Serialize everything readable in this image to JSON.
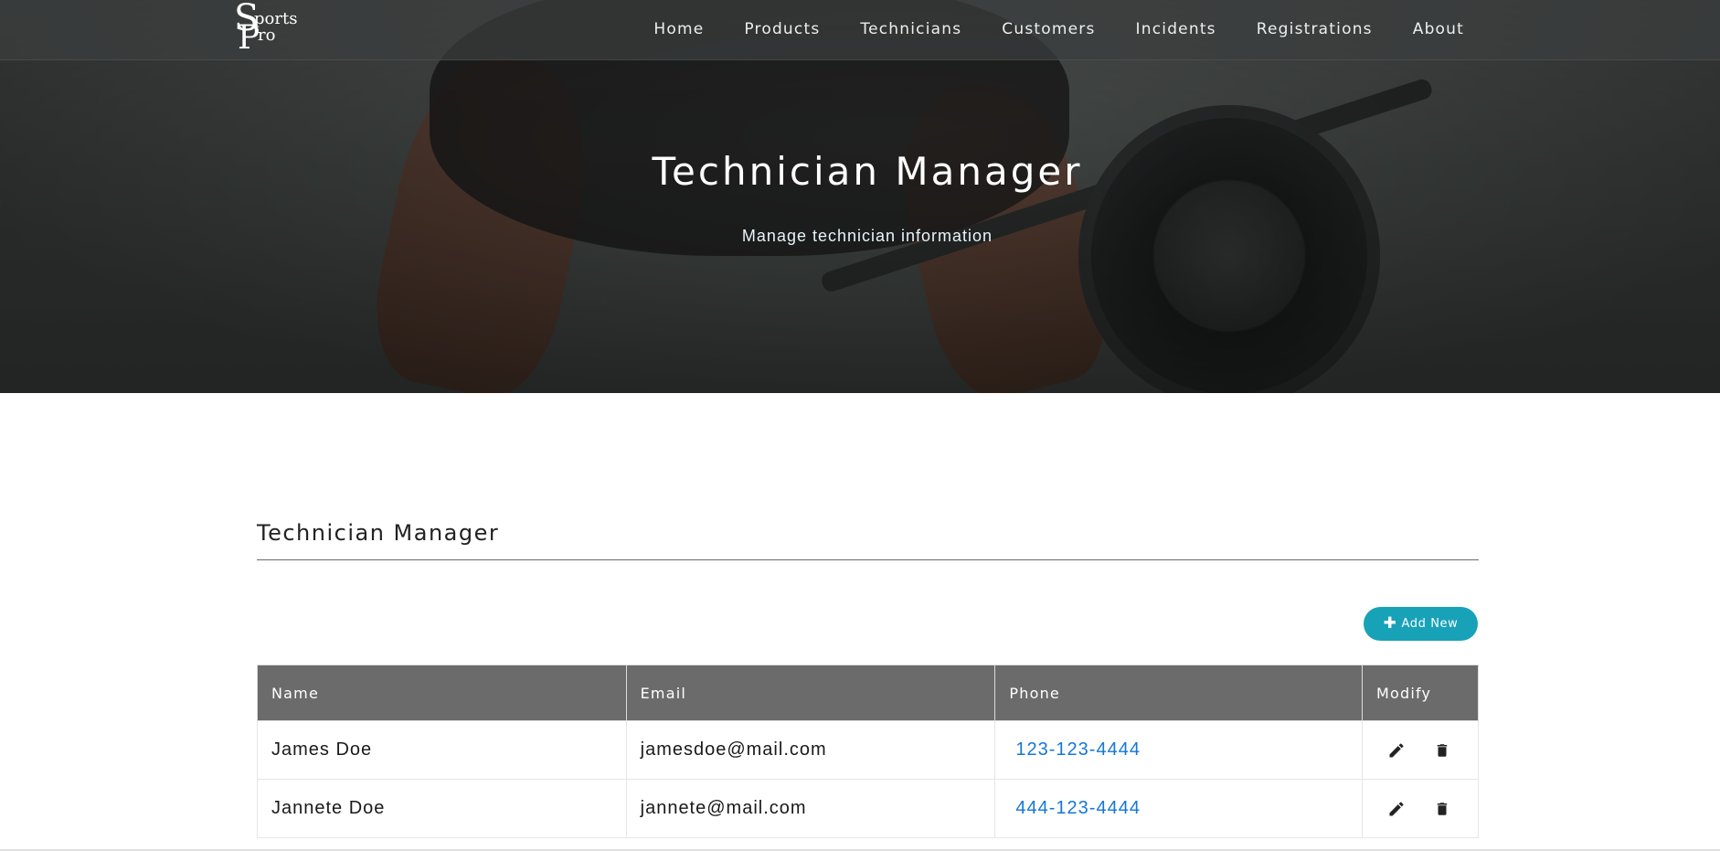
{
  "brand": {
    "logo_letter_s": "S",
    "logo_word_1": "ports",
    "logo_letter_p": "P",
    "logo_word_2": "ro"
  },
  "nav": {
    "items": [
      {
        "label": "Home"
      },
      {
        "label": "Products"
      },
      {
        "label": "Technicians"
      },
      {
        "label": "Customers"
      },
      {
        "label": "Incidents"
      },
      {
        "label": "Registrations"
      },
      {
        "label": "About"
      }
    ]
  },
  "hero": {
    "title": "Technician Manager",
    "subtitle": "Manage technician information"
  },
  "section": {
    "title": "Technician Manager"
  },
  "actions": {
    "add_new_label": "Add New",
    "add_new_icon": "plus-icon"
  },
  "table": {
    "headers": {
      "name": "Name",
      "email": "Email",
      "phone": "Phone",
      "modify": "Modify"
    },
    "rows": [
      {
        "name": "James Doe",
        "email": "jamesdoe@mail.com",
        "phone": "123-123-4444"
      },
      {
        "name": "Jannete Doe",
        "email": "jannete@mail.com",
        "phone": "444-123-4444"
      }
    ],
    "row_actions": [
      "pencil-icon",
      "trash-icon"
    ]
  },
  "colors": {
    "accent": "#17a2b8",
    "table_header": "#6b6b6b",
    "phone_link": "#1577d4"
  }
}
